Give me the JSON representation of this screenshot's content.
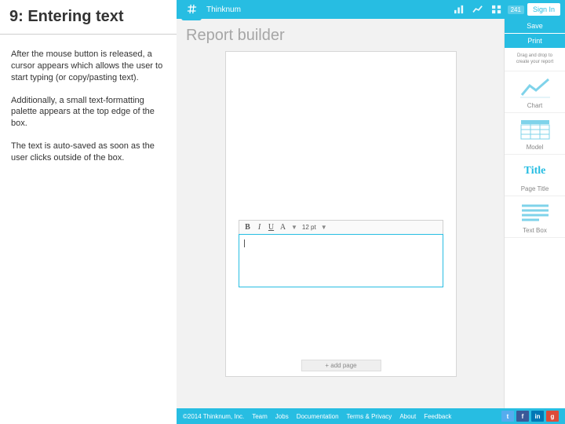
{
  "explain": {
    "title": "9: Entering text",
    "p1": "After the mouse button is released, a cursor appears which allows the user to start typing (or copy/pasting text).",
    "p2": "Additionally, a small text-formatting palette appears at the top edge of the box.",
    "p3": "The text is auto-saved as soon as the user clicks outside of the box."
  },
  "topbar": {
    "brand": "Thinknum",
    "count": "241",
    "signin": "Sign In"
  },
  "canvas": {
    "title": "Report builder",
    "addpage": "+ add page"
  },
  "fmt": {
    "bold": "B",
    "italic": "I",
    "under": "U",
    "font": "A",
    "size": "12 pt",
    "dd": "▼"
  },
  "toolbox": {
    "save": "Save",
    "print": "Print",
    "hint1": "Drag and drop to",
    "hint2": "create your report",
    "chart": "Chart",
    "model": "Model",
    "title_word": "Title",
    "pagetitle": "Page Title",
    "textbox": "Text Box"
  },
  "footer": {
    "copyright": "©2014 Thinknum, Inc.",
    "links": [
      "Team",
      "Jobs",
      "Documentation",
      "Terms & Privacy",
      "About",
      "Feedback"
    ]
  },
  "colors": {
    "accent": "#27bde2"
  }
}
